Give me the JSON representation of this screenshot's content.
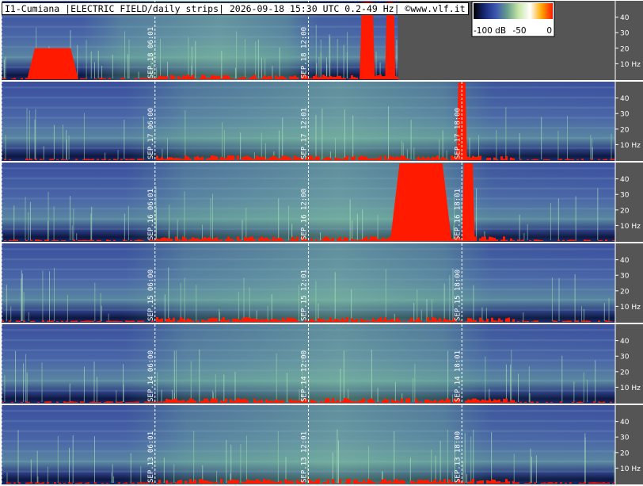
{
  "chart_data": {
    "type": "heatmap",
    "title": "I1-Cumiana |ELECTRIC FIELD/daily strips| 2026-09-18 15:30 UTC 0.2-49 Hz| ©www.vlf.it",
    "ylabel": "Hz",
    "y_ticks": [
      "40",
      "30",
      "20",
      "10 Hz"
    ],
    "ylim": [
      0.2,
      49
    ],
    "colorbar": {
      "min_label": "-100 dB",
      "mid_label": "-50",
      "max_label": "0",
      "range_db": [
        -100,
        0
      ],
      "colors": [
        "#000000",
        "#1a2a7a",
        "#3e58b0",
        "#6aa08a",
        "#c8e8a8",
        "#ffffff",
        "#ffa800",
        "#ff1a00"
      ]
    },
    "strips": [
      {
        "date": "SEP.18",
        "marks": [
          {
            "label": "SEP.18 06:01",
            "hour": 6
          },
          {
            "label": "SEP.18 12:00",
            "hour": 12
          }
        ],
        "end_hour": 15.5,
        "red_events": [
          [
            1,
            3,
            0.4
          ],
          [
            14,
            14.6,
            1.0
          ],
          [
            15,
            15.4,
            1.0
          ]
        ]
      },
      {
        "date": "SEP.17",
        "marks": [
          {
            "label": "SEP.17 06:00",
            "hour": 6
          },
          {
            "label": "SEP.17 12:01",
            "hour": 12
          },
          {
            "label": "SEP.17 18:00",
            "hour": 18
          }
        ],
        "end_hour": 24,
        "red_events": [
          [
            17.8,
            18.2,
            1.0
          ]
        ]
      },
      {
        "date": "SEP.16",
        "marks": [
          {
            "label": "SEP.16 06:01",
            "hour": 6
          },
          {
            "label": "SEP.16 12:00",
            "hour": 12
          },
          {
            "label": "SEP.16 18:01",
            "hour": 18
          }
        ],
        "end_hour": 24,
        "red_events": [
          [
            15.2,
            17.6,
            1.0
          ],
          [
            18,
            18.5,
            1.0
          ]
        ]
      },
      {
        "date": "SEP.15",
        "marks": [
          {
            "label": "SEP.15 06:00",
            "hour": 6
          },
          {
            "label": "SEP.15 12:01",
            "hour": 12
          },
          {
            "label": "SEP.15 18:00",
            "hour": 18
          }
        ],
        "end_hour": 24,
        "red_events": []
      },
      {
        "date": "SEP.14",
        "marks": [
          {
            "label": "SEP.14 06:00",
            "hour": 6
          },
          {
            "label": "SEP.14 12:00",
            "hour": 12
          },
          {
            "label": "SEP.14 18:01",
            "hour": 18
          }
        ],
        "end_hour": 24,
        "red_events": []
      },
      {
        "date": "SEP.13",
        "marks": [
          {
            "label": "SEP.13 06:01",
            "hour": 6
          },
          {
            "label": "SEP.13 12:01",
            "hour": 12
          },
          {
            "label": "SEP.13 18:00",
            "hour": 18
          }
        ],
        "end_hour": 24,
        "red_events": []
      }
    ]
  }
}
